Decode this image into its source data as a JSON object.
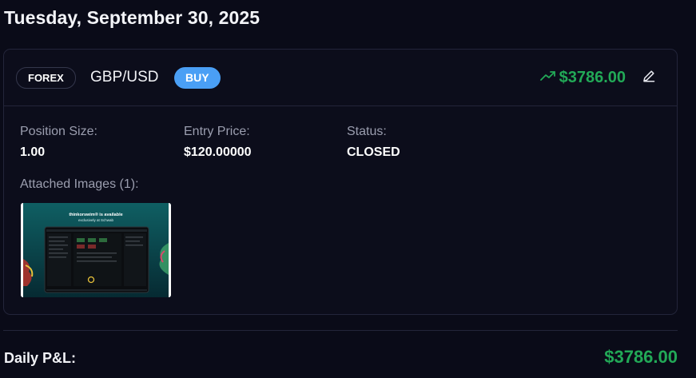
{
  "date_heading": "Tuesday, September 30, 2025",
  "trade": {
    "market_badge": "FOREX",
    "pair": "GBP/USD",
    "side_badge": "BUY",
    "pnl": "$3786.00",
    "pnl_icon": "trending-up-icon",
    "edit_icon": "pencil-icon",
    "fields": [
      {
        "label": "Position Size:",
        "value": "1.00"
      },
      {
        "label": "Entry Price:",
        "value": "$120.00000"
      },
      {
        "label": "Status:",
        "value": "CLOSED"
      }
    ],
    "attached_images_label": "Attached Images (1):",
    "thumbnail": {
      "headline": "thinkorswim® is available",
      "subline": "exclusively at Schwab"
    }
  },
  "daily": {
    "label": "Daily P&L:",
    "value": "$3786.00"
  },
  "colors": {
    "background": "#0a0b18",
    "card_border": "#23253a",
    "profit_green": "#22a957",
    "buy_blue": "#4a9ff5",
    "muted_text": "#9b9eaf"
  }
}
